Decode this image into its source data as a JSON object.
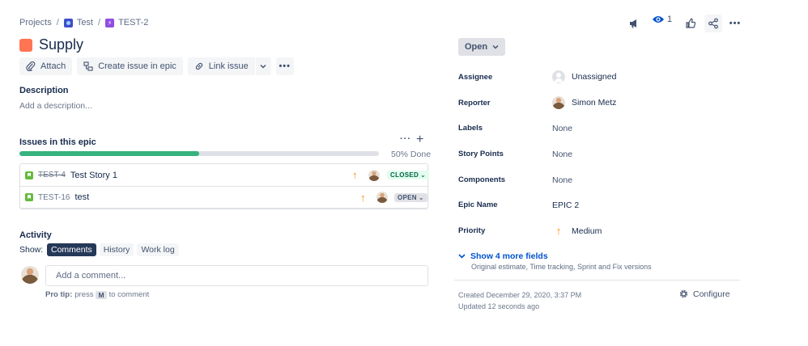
{
  "breadcrumb": {
    "projects": "Projects",
    "sep": "/",
    "project": "Test",
    "epic_key": "TEST-2"
  },
  "issue": {
    "title": "Supply"
  },
  "toolbar": {
    "attach": "Attach",
    "create_in_epic": "Create issue in epic",
    "link_issue": "Link issue"
  },
  "description": {
    "heading": "Description",
    "placeholder": "Add a description..."
  },
  "epic_issues": {
    "heading": "Issues in this epic",
    "progress_label": "50% Done",
    "progress": 0.5,
    "rows": [
      {
        "key": "TEST-4",
        "summary": "Test Story 1",
        "status": "CLOSED",
        "done": true
      },
      {
        "key": "TEST-16",
        "summary": "test",
        "status": "OPEN",
        "done": false
      }
    ]
  },
  "activity": {
    "heading": "Activity",
    "show_label": "Show:",
    "tabs": [
      "Comments",
      "History",
      "Work log"
    ],
    "comment_placeholder": "Add a comment...",
    "protip_prefix": "Pro tip:",
    "protip_press": "press",
    "protip_key": "M",
    "protip_suffix": "to comment"
  },
  "top_actions": {
    "watch_count": "1"
  },
  "status": {
    "label": "Open"
  },
  "fields": {
    "assignee": {
      "label": "Assignee",
      "value": "Unassigned"
    },
    "reporter": {
      "label": "Reporter",
      "value": "Simon Metz"
    },
    "labels": {
      "label": "Labels",
      "value": "None"
    },
    "story_points": {
      "label": "Story Points",
      "value": "None"
    },
    "components": {
      "label": "Components",
      "value": "None"
    },
    "epic_name": {
      "label": "Epic Name",
      "value": "EPIC 2"
    },
    "priority": {
      "label": "Priority",
      "value": "Medium"
    }
  },
  "more_fields": {
    "label": "Show 4 more fields",
    "sub": "Original estimate, Time tracking, Sprint and Fix versions"
  },
  "meta": {
    "created": "Created December 29, 2020, 3:37 PM",
    "updated": "Updated 12 seconds ago",
    "configure": "Configure"
  },
  "colors": {
    "epic": "#ff7452",
    "progress": "#36b37e",
    "link": "#0052cc",
    "closed_bg": "#e3fcef",
    "priority": "#ff8b00"
  }
}
